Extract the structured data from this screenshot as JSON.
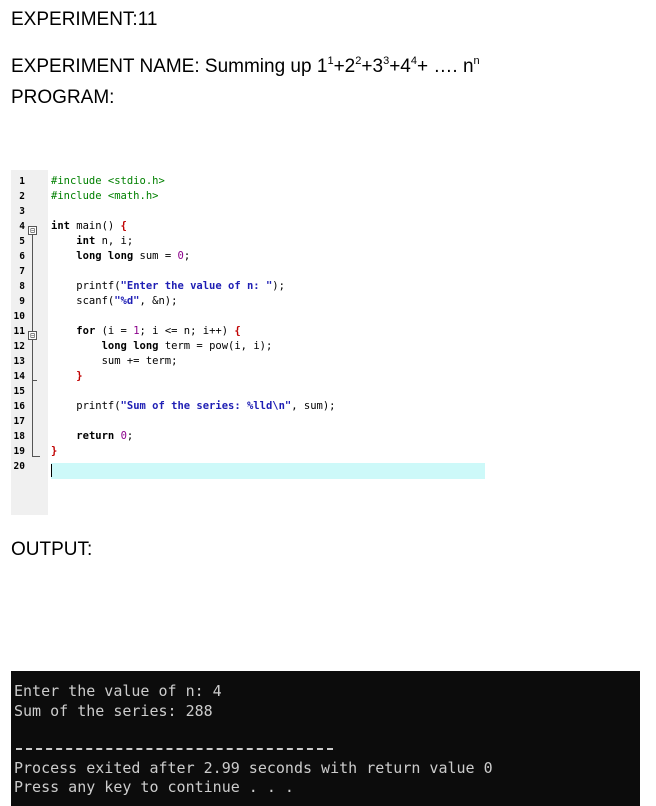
{
  "document": {
    "experiment_number": "EXPERIMENT:11",
    "experiment_name_prefix": "EXPERIMENT NAME: Summing up ",
    "series_terms": [
      {
        "base": "1",
        "exp": "1",
        "after": "+"
      },
      {
        "base": "2",
        "exp": "2",
        "after": "+"
      },
      {
        "base": "3",
        "exp": "3",
        "after": "+"
      },
      {
        "base": "4",
        "exp": "4",
        "after": "+ …. "
      },
      {
        "base": "n",
        "exp": "n",
        "after": ""
      }
    ],
    "program_label": "PROGRAM:",
    "output_label": "OUTPUT:"
  },
  "editor": {
    "line_numbers": [
      "1",
      "2",
      "3",
      "4",
      "5",
      "6",
      "7",
      "8",
      "9",
      "10",
      "11",
      "12",
      "13",
      "14",
      "15",
      "16",
      "17",
      "18",
      "19",
      "20"
    ],
    "lines": [
      "#include <stdio.h>",
      "#include <math.h>",
      "",
      "int main() {",
      "    int n, i;",
      "    long long sum = 0;",
      "",
      "    printf(\"Enter the value of n: \");",
      "    scanf(\"%d\", &n);",
      "",
      "    for (i = 1; i <= n; i++) {",
      "        long long term = pow(i, i);",
      "        sum += term;",
      "    }",
      "",
      "    printf(\"Sum of the series: %lld\\n\", sum);",
      "",
      "    return 0;",
      "}",
      ""
    ],
    "fold_markers": [
      "⊟",
      "⊟"
    ],
    "current_line": 20,
    "colors": {
      "preprocessor": "#008000",
      "string": "#1e1eb4",
      "number": "#8b008b",
      "current_line_highlight": "#cdf9f9",
      "gutter": "#f0f0f0"
    }
  },
  "console": {
    "lines": [
      "Enter the value of n: 4",
      "Sum of the series: 288",
      "Process exited after 2.99 seconds with return value 0",
      "Press any key to continue . . ."
    ],
    "colors": {
      "background": "#0c0c0c",
      "text": "#cccccc"
    }
  }
}
